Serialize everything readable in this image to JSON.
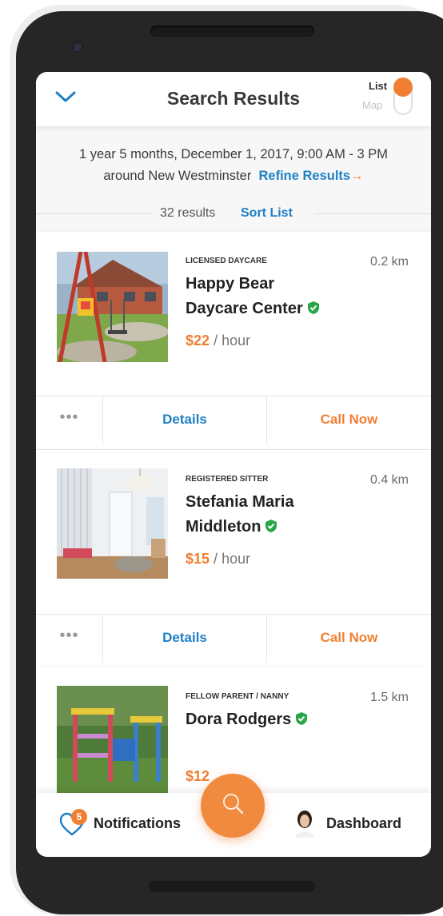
{
  "header": {
    "title": "Search Results",
    "toggle_list": "List",
    "toggle_map": "Map"
  },
  "criteria": {
    "line1": "1 year 5 months, December 1, 2017, 9:00 AM - 3 PM",
    "line2": "around New Westminster",
    "refine_label": "Refine Results",
    "refine_arrow": "→"
  },
  "results": {
    "count_text": "32 results",
    "sort_label": "Sort List"
  },
  "cards": [
    {
      "category": "LICENSED DAYCARE",
      "distance": "0.2 km",
      "name_line1": "Happy Bear",
      "name_line2": "Daycare Center",
      "price": "$22",
      "price_unit": "/ hour",
      "more": "•••",
      "details": "Details",
      "call": "Call Now"
    },
    {
      "category": "REGISTERED SITTER",
      "distance": "0.4 km",
      "name_line1": "Stefania Maria",
      "name_line2": "Middleton",
      "price": "$15",
      "price_unit": "/ hour",
      "more": "•••",
      "details": "Details",
      "call": "Call Now"
    },
    {
      "category": "FELLOW PARENT / NANNY",
      "distance": "1.5 km",
      "name_line1": "Dora Rodgers",
      "price": "$12"
    }
  ],
  "bottom_nav": {
    "notifications_label": "Notifications",
    "notifications_count": "5",
    "dashboard_label": "Dashboard",
    "search_icon": "search-icon"
  },
  "colors": {
    "accent_orange": "#f07f32",
    "accent_blue": "#1f80c6",
    "verified_green": "#2aa64a"
  }
}
